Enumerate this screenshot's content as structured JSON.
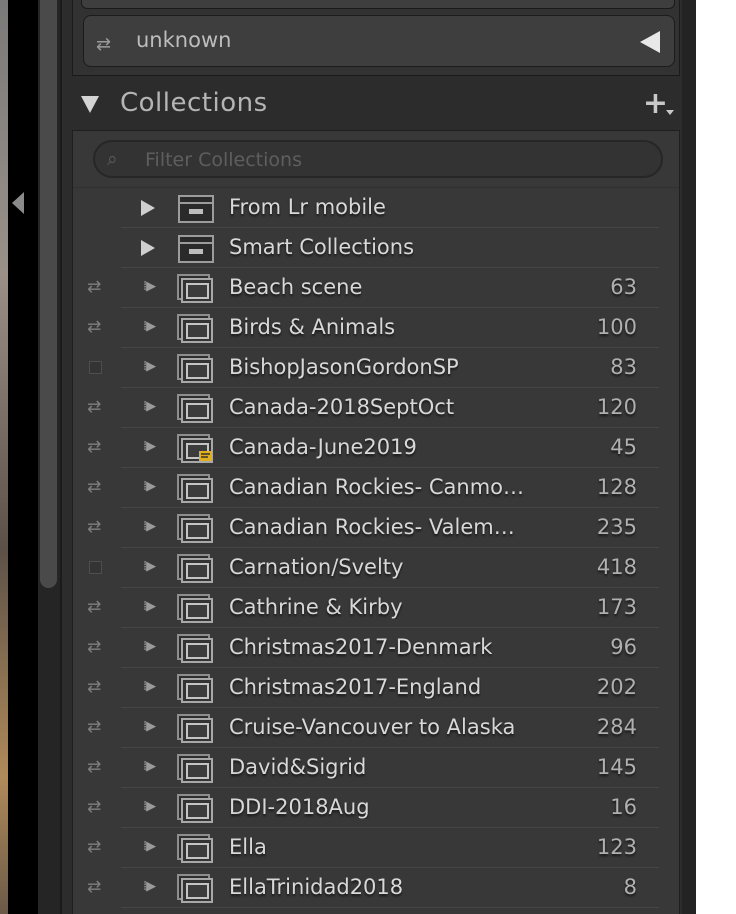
{
  "top_dropdown": {
    "label": "unknown",
    "sync_icon": "sync-arrows-icon",
    "caret_icon": "caret-left-icon"
  },
  "collections": {
    "title": "Collections",
    "add_label": "+",
    "filter_placeholder": "Filter Collections",
    "sets": [
      {
        "name": "From Lr mobile"
      },
      {
        "name": "Smart Collections"
      }
    ],
    "items": [
      {
        "name": "Beach scene",
        "count": "63",
        "synced": true,
        "comment": false
      },
      {
        "name": "Birds & Animals",
        "count": "100",
        "synced": true,
        "comment": false
      },
      {
        "name": "BishopJasonGordonSP",
        "count": "83",
        "synced": false,
        "comment": false
      },
      {
        "name": "Canada-2018SeptOct",
        "count": "120",
        "synced": true,
        "comment": false
      },
      {
        "name": "Canada-June2019",
        "count": "45",
        "synced": true,
        "comment": true
      },
      {
        "name": "Canadian Rockies- Canmo…",
        "count": "128",
        "synced": true,
        "comment": false
      },
      {
        "name": "Canadian Rockies- Valem…",
        "count": "235",
        "synced": true,
        "comment": false
      },
      {
        "name": "Carnation/Svelty",
        "count": "418",
        "synced": false,
        "comment": false
      },
      {
        "name": "Cathrine & Kirby",
        "count": "173",
        "synced": true,
        "comment": false
      },
      {
        "name": "Christmas2017-Denmark",
        "count": "96",
        "synced": true,
        "comment": false
      },
      {
        "name": "Christmas2017-England",
        "count": "202",
        "synced": true,
        "comment": false
      },
      {
        "name": "Cruise-Vancouver to Alaska",
        "count": "284",
        "synced": true,
        "comment": false
      },
      {
        "name": "David&Sigrid",
        "count": "145",
        "synced": true,
        "comment": false
      },
      {
        "name": "DDI-2018Aug",
        "count": "16",
        "synced": true,
        "comment": false
      },
      {
        "name": "Ella",
        "count": "123",
        "synced": true,
        "comment": false
      },
      {
        "name": "EllaTrinidad2018",
        "count": "8",
        "synced": true,
        "comment": false
      }
    ]
  },
  "colors": {
    "panel": "#2c2c2c",
    "list": "#383838",
    "text": "#d8d8d8",
    "comment_badge": "#e0b020"
  }
}
